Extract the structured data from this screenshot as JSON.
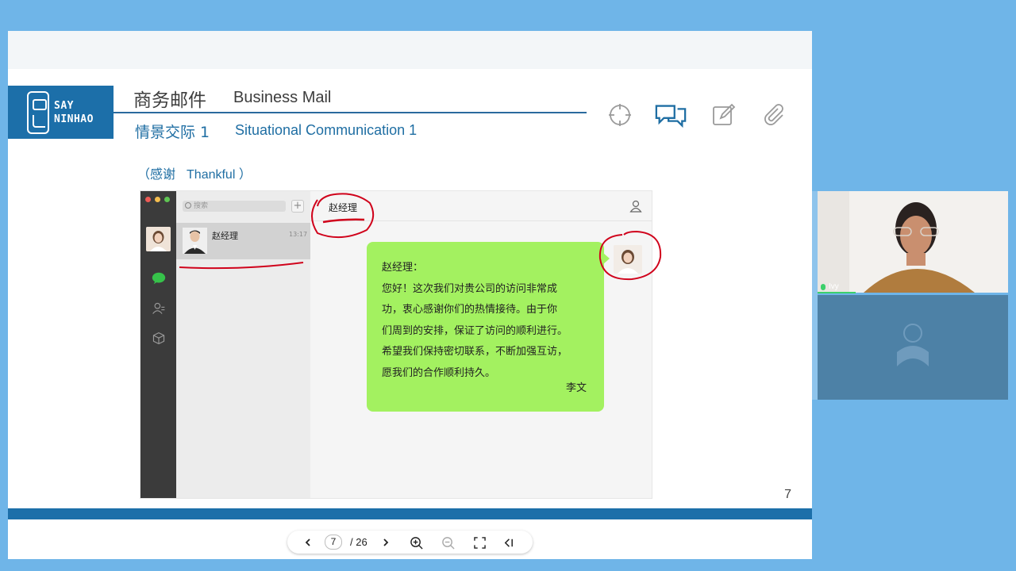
{
  "slide": {
    "logo_line1": "SAY",
    "logo_line2": "NINHAO",
    "title_cn": "商务邮件",
    "title_en": "Business Mail",
    "subtitle_cn": "情景交际 1",
    "subtitle_en": "Situational Communication 1",
    "caption_cn": "（感谢",
    "caption_en": "Thankful ）",
    "page_number": "7",
    "tools": [
      "target-icon",
      "chat-bubbles-icon",
      "edit-icon",
      "paperclip-icon"
    ]
  },
  "chat": {
    "search_placeholder": "搜索",
    "add_label": "+",
    "contact": {
      "name": "赵经理",
      "time": "13:17"
    },
    "conversation_title": "赵经理",
    "message_lines": [
      "赵经理：",
      "您好！这次我们对贵公司的访问非常成",
      "功，衷心感谢你们的热情接待。由于你",
      "们周到的安排，保证了访问的顺利进行。",
      "希望我们保持密切联系，不断加强互访，",
      "愿我们的合作顺利持久。"
    ],
    "signature": "李文"
  },
  "viewer": {
    "current_page": "7",
    "total_pages": "/ 26"
  },
  "video": {
    "participant_name": "Ivy"
  },
  "colors": {
    "brand_blue": "#1c6fa9",
    "bubble_green": "#a3f160",
    "annotation_red": "#d0021b",
    "background": "#6fb5e8"
  }
}
